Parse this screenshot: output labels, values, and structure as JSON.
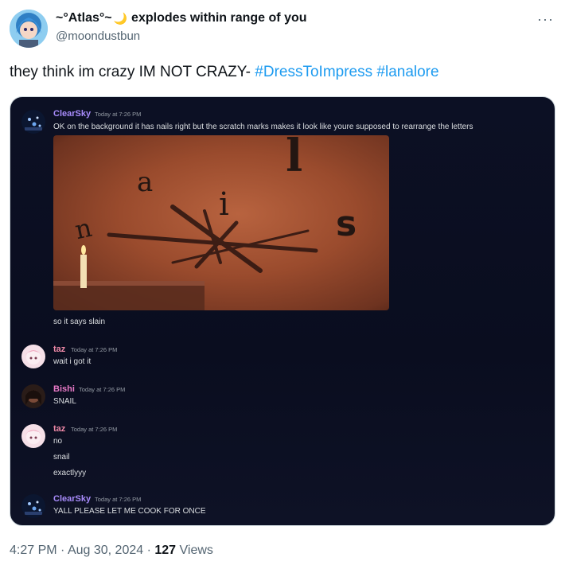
{
  "author": {
    "display_name": "~°Atlas°~",
    "emoji": "🌙",
    "name_suffix": "explodes within range of you",
    "handle": "@moondustbun"
  },
  "more_icon": "···",
  "tweet": {
    "text_plain": "they think im crazy IM NOT CRAZY- ",
    "hashtag1": "#DressToImpress",
    "hashtag2": "#lanalore"
  },
  "chat": {
    "messages": [
      {
        "author": "ClearSky",
        "author_color": "#a78bfa",
        "time": "Today at 7:26 PM",
        "lines": [
          "OK on the background it has nails right but the scratch marks makes it look like youre supposed to rearrange the letters"
        ],
        "followup": "so it says slain"
      },
      {
        "author": "taz",
        "author_color": "#f08aa8",
        "time": "Today at 7:26 PM",
        "lines": [
          "wait i got it"
        ]
      },
      {
        "author": "Bishi",
        "author_color": "#e879c6",
        "time": "Today at 7:26 PM",
        "lines": [
          "SNAIL"
        ]
      },
      {
        "author": "taz",
        "author_color": "#f08aa8",
        "time": "Today at 7:26 PM",
        "lines": [
          "no",
          "snail",
          "exactlyyy"
        ]
      },
      {
        "author": "ClearSky",
        "author_color": "#a78bfa",
        "time": "Today at 7:26 PM",
        "lines": [
          "YALL PLEASE LET ME COOK FOR ONCE"
        ]
      }
    ],
    "image_letters": [
      "a",
      "l",
      "i",
      "n",
      "s"
    ]
  },
  "footer": {
    "time": "4:27 PM",
    "sep1": " · ",
    "date": "Aug 30, 2024",
    "sep2": " · ",
    "views": "127",
    "views_label": " Views"
  }
}
